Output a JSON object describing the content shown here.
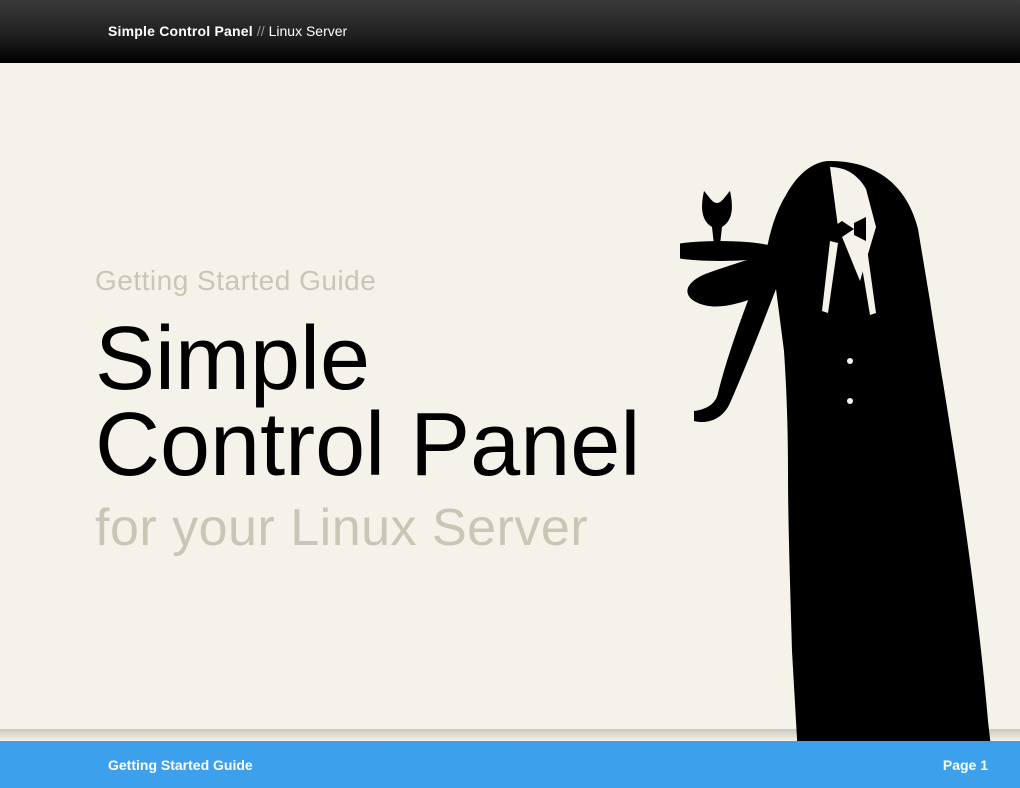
{
  "header": {
    "title_bold": "Simple Control Panel",
    "separator": "//",
    "title_sub": "Linux Server"
  },
  "hero": {
    "eyebrow": "Getting Started Guide",
    "title_line1": "Simple",
    "title_line2": "Control Panel",
    "subtitle": "for your Linux Server"
  },
  "footer": {
    "left": "Getting Started Guide",
    "right": "Page 1"
  }
}
